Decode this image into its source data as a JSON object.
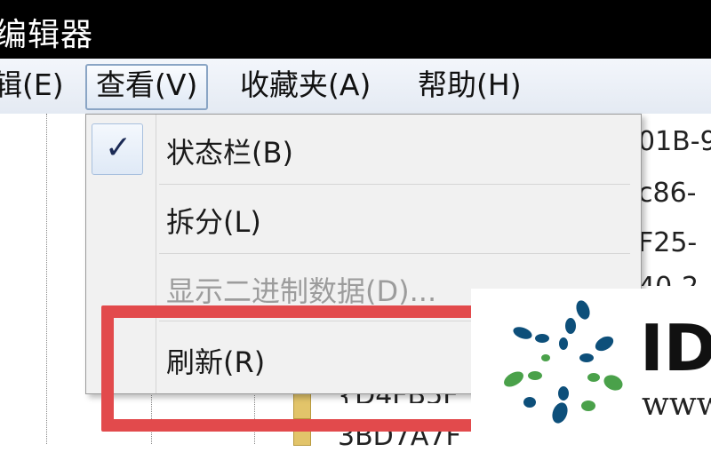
{
  "window": {
    "title": "编辑器"
  },
  "menubar": {
    "items": [
      {
        "label": "辑(E)"
      },
      {
        "label": "查看(V)"
      },
      {
        "label": "收藏夹(A)"
      },
      {
        "label": "帮助(H)"
      }
    ]
  },
  "dropdown": {
    "items": [
      {
        "label": "状态栏(B)",
        "checked": true,
        "enabled": true
      },
      {
        "label": "拆分(L)",
        "checked": false,
        "enabled": true
      },
      {
        "label": "显示二进制数据(D)...",
        "checked": false,
        "enabled": false
      },
      {
        "label": "刷新(R)",
        "checked": false,
        "enabled": true
      }
    ]
  },
  "background": {
    "right_fragments": [
      "01B-9",
      "c86-",
      "F25-",
      "40-2"
    ],
    "lower_fragments": [
      "{D4FB5F",
      "3BD7A7F"
    ]
  },
  "watermark": {
    "text": "ID",
    "sub": "www",
    "colors": [
      "#0d4f7a",
      "#4aa14a"
    ]
  },
  "colors": {
    "highlight": "#e24a4c",
    "titlebar": "#000000"
  }
}
